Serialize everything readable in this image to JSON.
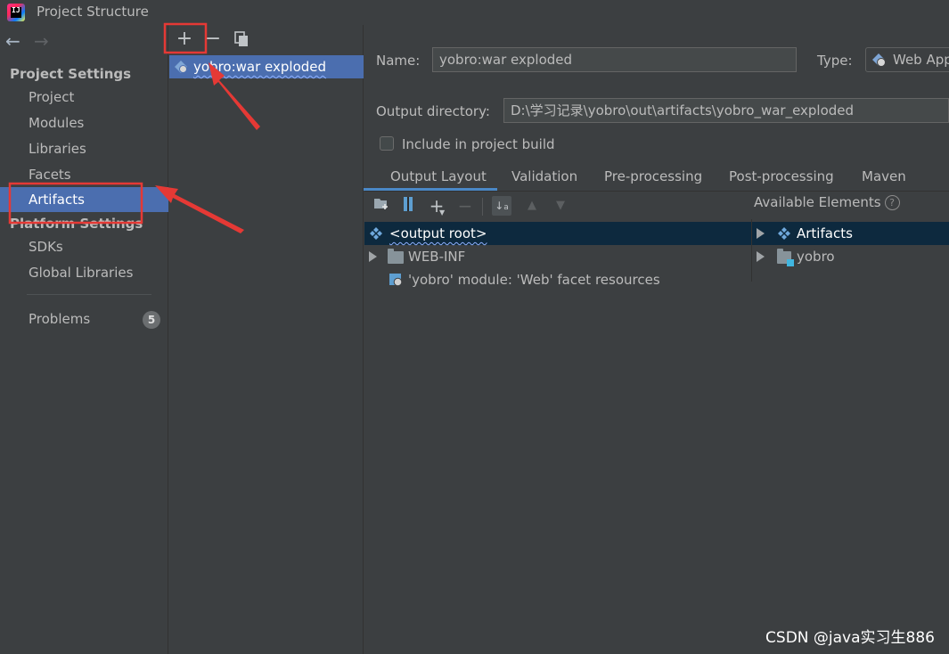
{
  "window": {
    "title": "Project Structure"
  },
  "sidebar": {
    "project_settings_header": "Project Settings",
    "platform_settings_header": "Platform Settings",
    "items": [
      {
        "label": "Project"
      },
      {
        "label": "Modules"
      },
      {
        "label": "Libraries"
      },
      {
        "label": "Facets"
      },
      {
        "label": "Artifacts",
        "selected": true
      },
      {
        "label": "SDKs"
      },
      {
        "label": "Global Libraries"
      },
      {
        "label": "Problems",
        "badge": "5"
      }
    ]
  },
  "artifact_list": {
    "items": [
      {
        "label": "yobro:war exploded",
        "icon": "web-artifact-icon"
      }
    ]
  },
  "detail": {
    "name_label": "Name:",
    "name_value": "yobro:war exploded",
    "type_label": "Type:",
    "type_value": "Web App",
    "output_dir_label": "Output directory:",
    "output_dir_value": "D:\\学习记录\\yobro\\out\\artifacts\\yobro_war_exploded",
    "include_label": "Include in project build",
    "include_checked": false,
    "tabs": [
      {
        "label": "Output Layout",
        "active": true
      },
      {
        "label": "Validation"
      },
      {
        "label": "Pre-processing"
      },
      {
        "label": "Post-processing"
      },
      {
        "label": "Maven"
      }
    ],
    "layout_tree": [
      {
        "label": "<output root>",
        "icon": "artifact-diamond-icon",
        "selected": true
      },
      {
        "label": "WEB-INF",
        "icon": "folder-icon",
        "expandable": true
      },
      {
        "label": "'yobro' module: 'Web' facet resources",
        "icon": "web-facet-icon"
      }
    ],
    "available_label": "Available Elements",
    "available_tree": [
      {
        "label": "Artifacts",
        "icon": "artifact-diamond-icon",
        "selected": true
      },
      {
        "label": "yobro",
        "icon": "module-folder-icon"
      }
    ]
  },
  "watermark": "CSDN @java实习生886",
  "colors": {
    "selection": "#4b6eaf",
    "tree_selection": "#0d293e",
    "annotation": "#e53935"
  }
}
